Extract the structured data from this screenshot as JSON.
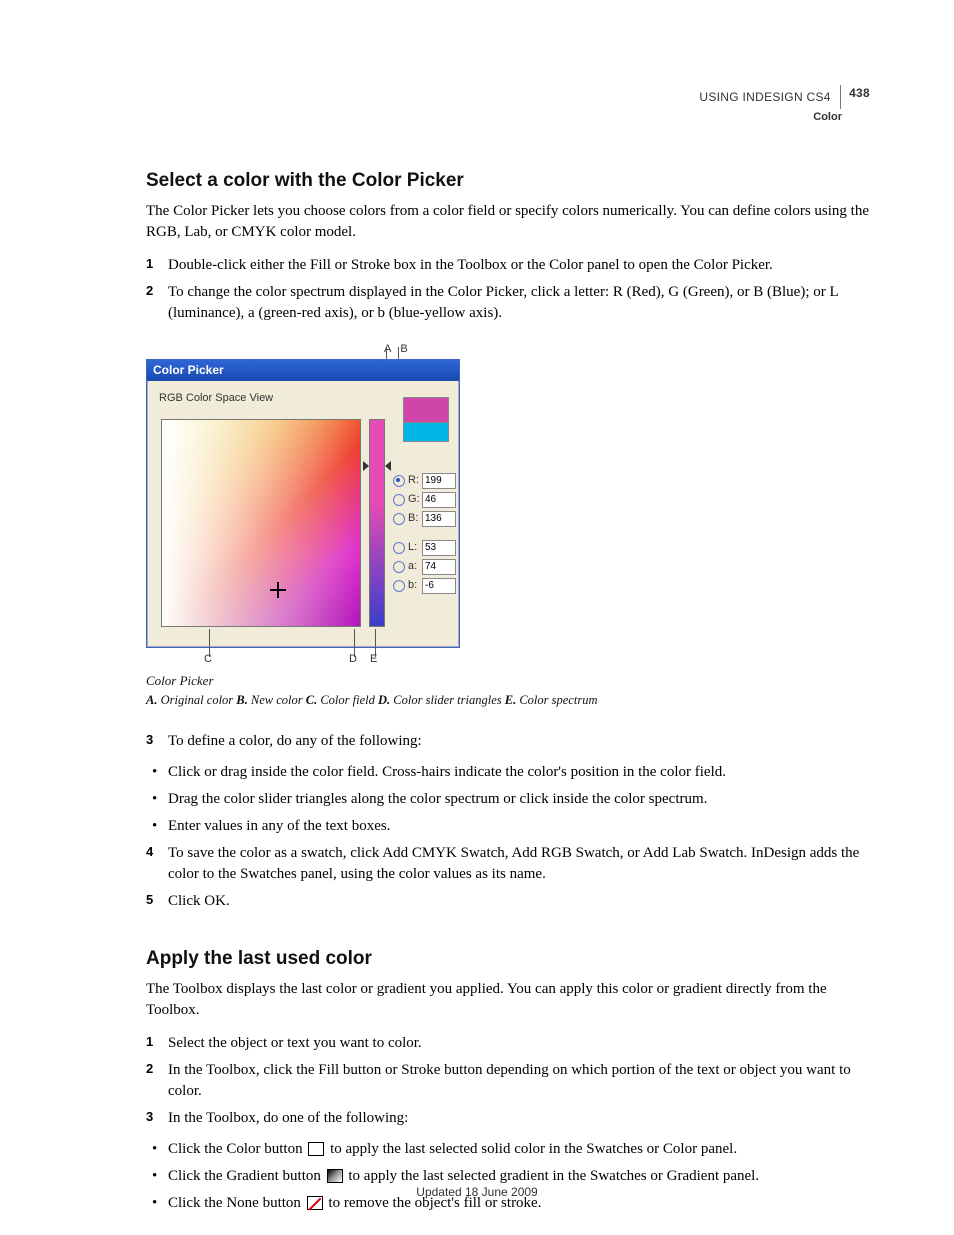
{
  "header": {
    "product": "USING INDESIGN CS4",
    "section": "Color",
    "page": "438"
  },
  "s1": {
    "title": "Select a color with the Color Picker",
    "intro": "The Color Picker lets you choose colors from a color field or specify colors numerically. You can define colors using the RGB, Lab, or CMYK color model.",
    "step1": "Double-click either the Fill or Stroke box in the Toolbox or the Color panel to open the Color Picker.",
    "step2": "To change the color spectrum displayed in the Color Picker, click a letter: R (Red), G (Green), or B (Blue); or L (luminance), a (green-red axis), or b (blue-yellow axis).",
    "step3": "To define a color, do any of the following:",
    "b1": "Click or drag inside the color field. Cross-hairs indicate the color's position in the color field.",
    "b2": "Drag the color slider triangles along the color spectrum or click inside the color spectrum.",
    "b3": "Enter values in any of the text boxes.",
    "step4": "To save the color as a swatch, click Add CMYK Swatch, Add RGB Swatch, or Add Lab Swatch. InDesign adds the color to the Swatches panel, using the color values as its name.",
    "step5": "Click OK."
  },
  "figure": {
    "topA": "A",
    "topB": "B",
    "botC": "C",
    "botD": "D",
    "botE": "E",
    "title": "Color Picker",
    "viewLabel": "RGB Color Space View",
    "inputs": {
      "R": "199",
      "G": "46",
      "B": "136",
      "L": "53",
      "a": "74",
      "b": "-6"
    },
    "caption": "Color Picker",
    "legend_a": "A.",
    "legend_a_txt": " Original color  ",
    "legend_b": "B.",
    "legend_b_txt": " New color  ",
    "legend_c": "C.",
    "legend_c_txt": " Color field  ",
    "legend_d": "D.",
    "legend_d_txt": " Color slider triangles  ",
    "legend_e": "E.",
    "legend_e_txt": " Color spectrum"
  },
  "s2": {
    "title": "Apply the last used color",
    "intro": "The Toolbox displays the last color or gradient you applied. You can apply this color or gradient directly from the Toolbox.",
    "step1": "Select the object or text you want to color.",
    "step2": "In the Toolbox, click the Fill button or Stroke button depending on which portion of the text or object you want to color.",
    "step3": "In the Toolbox, do one of the following:",
    "b1a": "Click the Color button ",
    "b1b": " to apply the last selected solid color in the Swatches or Color panel.",
    "b2a": "Click the Gradient button ",
    "b2b": " to apply the last selected gradient in the Swatches or Gradient panel.",
    "b3a": "Click the None button ",
    "b3b": " to remove the object's fill or stroke."
  },
  "footer": "Updated 18 June 2009"
}
